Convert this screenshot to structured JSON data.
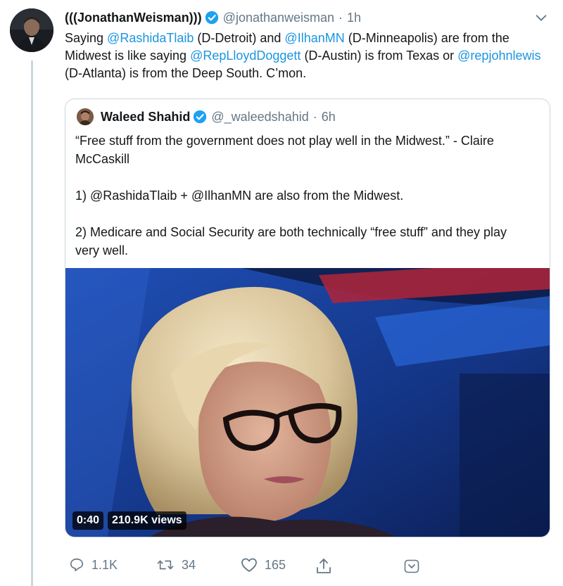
{
  "tweet": {
    "author": {
      "display_name": "(((JonathanWeisman)))",
      "handle": "@jonathanweisman",
      "time": "1h"
    },
    "text": {
      "part1": "Saying ",
      "m1": "@RashidaTlaib",
      "part2": " (D-Detroit) and ",
      "m2": "@IlhanMN",
      "part3": " (D-Minneapolis) are from the Midwest is like saying ",
      "m3": "@RepLloydDoggett",
      "part4": " (D-Austin) is from Texas or ",
      "m4": "@repjohnlewis",
      "part5": " (D-Atlanta) is from the Deep South. C’mon."
    }
  },
  "quoted_tweet": {
    "author": {
      "display_name": "Waleed Shahid",
      "handle": "@_waleedshahid",
      "time": "6h"
    },
    "paragraphs": [
      "“Free stuff from the government does not play well in the Midwest.” - Claire McCaskill",
      "1) @RashidaTlaib + @IlhanMN are also from the Midwest.",
      "2) Medicare and Social Security are both technically “free stuff” and they play very well."
    ],
    "video": {
      "duration": "0:40",
      "views": "210.9K views"
    }
  },
  "actions": {
    "replies": "1.1K",
    "retweets": "34",
    "likes": "165"
  },
  "colors": {
    "link": "#1b95e0",
    "secondary_text": "#657786",
    "verified": "#1da1f2"
  },
  "icons": [
    "verified-badge-icon",
    "chevron-down-icon",
    "reply-icon",
    "retweet-icon",
    "like-icon",
    "share-icon"
  ]
}
